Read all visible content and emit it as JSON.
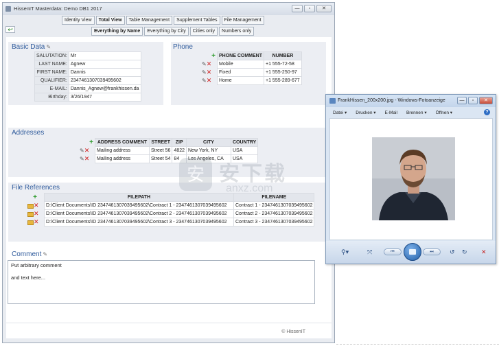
{
  "window": {
    "title": "HissenIT Masterdata: Demo DB1 2017"
  },
  "toolbar1": [
    "Identity View",
    "Total View",
    "Table Management",
    "Supplement Tables",
    "File Management"
  ],
  "toolbar2": [
    "Everything by Name",
    "Everything by City",
    "Cities only",
    "Numbers only"
  ],
  "basic": {
    "title": "Basic Data",
    "fields": [
      {
        "label": "SALUTATION:",
        "value": "Mr"
      },
      {
        "label": "LAST NAME:",
        "value": "Agnew"
      },
      {
        "label": "FIRST NAME:",
        "value": "Dannis"
      },
      {
        "label": "QUALIFIER:",
        "value": "2347461307039495602"
      },
      {
        "label": "E-MAIL:",
        "value": "Dannis_Agnew@frankhissen.da"
      },
      {
        "label": "Birthday:",
        "value": "3/26/1947"
      }
    ]
  },
  "phone": {
    "title": "Phone",
    "headers": [
      "PHONE COMMENT",
      "NUMBER"
    ],
    "rows": [
      {
        "comment": "Mobile",
        "number": "+1 555-72-58"
      },
      {
        "comment": "Fixed",
        "number": "+1 555-250-97"
      },
      {
        "comment": "Home",
        "number": "+1 555-289-677"
      }
    ]
  },
  "addresses": {
    "title": "Addresses",
    "headers": [
      "ADDRESS COMMENT",
      "STREET",
      "ZIP",
      "CITY",
      "COUNTRY"
    ],
    "rows": [
      {
        "comment": "Mailing address",
        "street": "Street 56",
        "zip": "4822",
        "city": "New York, NY",
        "country": "USA"
      },
      {
        "comment": "Mailing address",
        "street": "Street 54",
        "zip": "84",
        "city": "Los Angeles, CA",
        "country": "USA"
      }
    ]
  },
  "files": {
    "title": "File References",
    "headers": [
      "FILEPATH",
      "FILENAME"
    ],
    "rows": [
      {
        "path": "D:\\Client Documents\\ID 2347461307039495602\\Contract 1 - 2347461307039495602",
        "name": "Contract 1 - 2347461307039495602"
      },
      {
        "path": "D:\\Client Documents\\ID 2347461307039495602\\Contract 2 - 2347461307039495602",
        "name": "Contract 2 - 2347461307039495602"
      },
      {
        "path": "D:\\Client Documents\\ID 2347461307039495602\\Contract 3 - 2347461307039495602",
        "name": "Contract 3 - 2347461307039495602"
      }
    ]
  },
  "comment": {
    "title": "Comment",
    "lines": [
      "Put arbitrary comment",
      "",
      "and text here..."
    ]
  },
  "copyright": "© HissenIT",
  "watermark": {
    "text": "安下载",
    "url": "anxz.com"
  },
  "photo_viewer": {
    "title": "FrankHissen_200x200.jpg - Windows-Fotoanzeige",
    "menu": [
      "Datei ▾",
      "Drucken ▾",
      "E-Mail",
      "Brennen ▾",
      "Öffnen ▾"
    ],
    "help": "?"
  }
}
